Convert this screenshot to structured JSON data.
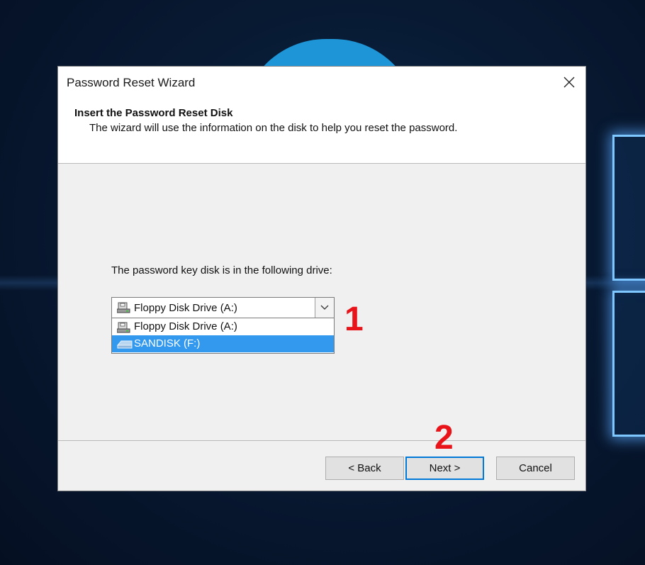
{
  "dialog": {
    "title": "Password Reset Wizard",
    "header_title": "Insert the Password Reset Disk",
    "header_subtitle": "The wizard will use the information on the disk to help you reset the password.",
    "body_label": "The password key disk is in the following drive:",
    "drive_select": {
      "selected": "Floppy Disk Drive (A:)",
      "options": [
        {
          "label": "Floppy Disk Drive (A:)",
          "icon": "floppy-drive-icon",
          "highlighted": false
        },
        {
          "label": "SANDISK (F:)",
          "icon": "usb-drive-icon",
          "highlighted": true
        }
      ]
    },
    "buttons": {
      "back": "< Back",
      "next": "Next >",
      "cancel": "Cancel"
    }
  },
  "annotations": {
    "step1": "1",
    "step2": "2"
  },
  "colors": {
    "accent": "#0078d7",
    "highlight": "#3399ee",
    "annotation": "#e8141a",
    "desktop": "#081a33"
  }
}
